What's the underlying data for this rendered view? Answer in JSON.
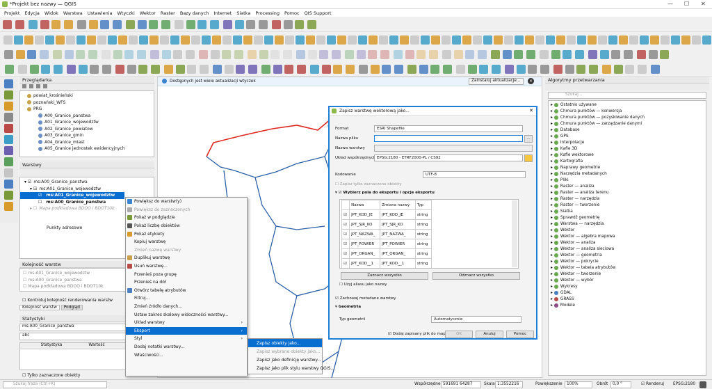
{
  "window": {
    "title": "*Projekt bez nazwy — QGIS"
  },
  "menu": [
    "Projekt",
    "Edycja",
    "Widok",
    "Warstwa",
    "Ustawienia",
    "Wtyczki",
    "Wektor",
    "Raster",
    "Bazy danych",
    "Internet",
    "Siatka",
    "Processing",
    "Pomoc",
    "QIS Support"
  ],
  "browser": {
    "title": "Przeglądarka",
    "items": [
      "powiat_krośnieński",
      "poznański_WFS",
      "PRG",
      "A00_Granice_panstwa",
      "A01_Granice_wojewodztw",
      "A02_Granice_powiatow",
      "A03_Granice_gmin",
      "A04_Granice_miast",
      "A05_Granice jednostek ewidencyjnych"
    ]
  },
  "layers": {
    "title": "Warstwy",
    "items": [
      "ms:A00_Granice_panstwa",
      "ms:A01_Granice_wojewodztw",
      "ms:A01_Granice_wojewodztw",
      "ms:A00_Granice_panstwa",
      "Mapa podkładowa BDOO i BDOT10k",
      "Punkty adresowe"
    ]
  },
  "order": {
    "title": "Kolejność warstw",
    "items": [
      "ms:A01_Granice_wojewodztw",
      "ms:A00_Granice_panstwa",
      "Mapa podkładowa BDOO i BDOT10k"
    ],
    "check": "Kontroluj kolejność renderowania warstw",
    "tabs": [
      "Kolejność warstw",
      "Podgląd"
    ]
  },
  "stats": {
    "title": "Statystyki",
    "layer": "ms:A00_Granice_panstwa",
    "field": "abc",
    "cols": [
      "Statystyka",
      "Wartość"
    ],
    "only_selected": "Tylko zaznaczone obiekty"
  },
  "notice": {
    "text": "Dostępnych jest wiele aktualizacji wtyczek",
    "button": "Zainstaluj aktualizacje..."
  },
  "context_menu": [
    "Powiększ do warstw(y)",
    "Powiększ do zaznaczonych",
    "Pokaż w podglądzie",
    "Pokaż liczbę obiektów",
    "Pokaż etykiety",
    "Kopiuj warstwę",
    "Zmień nazwę warstwy",
    "Duplikuj warstwę",
    "Usuń warstwę...",
    "Przenieś poza grupę",
    "Przenieś na dół",
    "Otwórz tabelę atrybutów",
    "Filtruj...",
    "Zmień źródło danych...",
    "Ustaw zakres skalowy widoczności warstwy...",
    "Układ warstwy",
    "Eksport",
    "Styl",
    "Dodaj notatki warstwy...",
    "Właściwości..."
  ],
  "submenu": [
    "Zapisz obiekty jako...",
    "Zapisz wybrane obiekty jako...",
    "Zapisz jako definicję warstwy...",
    "Zapisz jako plik stylu warstwy QGIS..."
  ],
  "dialog": {
    "title": "Zapisz warstwę wektorową jako...",
    "format_label": "Format",
    "format": "ESRI Shapefile",
    "file_label": "Nazwa pliku",
    "file": "",
    "layer_label": "Nazwa warstwy",
    "crs_label": "Układ współrzędnych",
    "crs": "EPSG:2180 - ETRF2000-PL / CS92",
    "enc_label": "Kodowanie",
    "enc": "UTF-8",
    "only_sel": "Zapisz tylko zaznaczone obiekty",
    "section": "Wybierz pola do eksportu i opcje eksportu",
    "cols": [
      "Nazwa",
      "Zmiana nazwy",
      "Typ"
    ],
    "rows": [
      [
        "JPT_KOD_JE",
        "JPT_KOD_JE",
        "string"
      ],
      [
        "JPT_SJR_KO",
        "JPT_SJR_KO",
        "string"
      ],
      [
        "JPT_NAZWA_",
        "JPT_NAZWA_",
        "string"
      ],
      [
        "JPT_POWIER",
        "JPT_POWIER",
        "string"
      ],
      [
        "JPT_ORGAN_",
        "JPT_ORGAN_",
        "string"
      ],
      [
        "JPT_KOD__1",
        "JPT_KOD__1",
        "string"
      ]
    ],
    "select_all": "Zaznacz wszystko",
    "deselect_all": "Odznacz wszystko",
    "alias": "Użyj aliasu jako nazwy",
    "metadata": "Zachowaj metadane warstwy",
    "geometry": "Geometria",
    "geom_type_label": "Typ geometrii",
    "geom_type": "Automatycznie",
    "add_to_map": "Dodaj zapisany plik do mapy",
    "ok": "OK",
    "cancel": "Anuluj",
    "help": "Pomoc"
  },
  "processing": {
    "title": "Algorytmy przetwarzania",
    "search": "Szukaj...",
    "items": [
      "Ostatnio używane",
      "Chmura punktów — konwersja",
      "Chmura punktów — pozyskiwanie danych",
      "Chmura punktów — zarządzanie danymi",
      "Database",
      "GPS",
      "Interpolacje",
      "Kafle 3D",
      "Kafle wektorowe",
      "Kartografia",
      "Naprawy geometrie",
      "Narzędzia metadanych",
      "Pliki",
      "Raster — analiza",
      "Raster — analiza terenu",
      "Raster — narzędzia",
      "Raster — tworzenie",
      "Siatka",
      "Sprawdź geometrię",
      "Warstwa — narzędzia",
      "Wektor",
      "Wektor — algebra mapowa",
      "Wektor — analiza",
      "Wektor — analiza sieciowa",
      "Wektor — geometria",
      "Wektor — pokrycie",
      "Wektor — tabela atrybutów",
      "Wektor — tworzenie",
      "Wektor — wybór",
      "Wykresy",
      "GDAL",
      "GRASS",
      "Modele"
    ]
  },
  "status": {
    "search": "Szukaj fraza (Ctrl+K)",
    "coord_label": "Współrzędne",
    "coord": "591691  64287",
    "scale_label": "Skala",
    "scale": "1:3552216",
    "mag_label": "Powiększenie",
    "mag": "100%",
    "rot_label": "Obrót",
    "rot": "0,0 °",
    "render": "Renderuj",
    "crs": "EPSG:2180"
  },
  "colors": {
    "accent": "#0a6ed1",
    "dialog_border": "#1e7fd6",
    "map_blue": "#2b5fa8",
    "map_red": "#e0261f"
  }
}
